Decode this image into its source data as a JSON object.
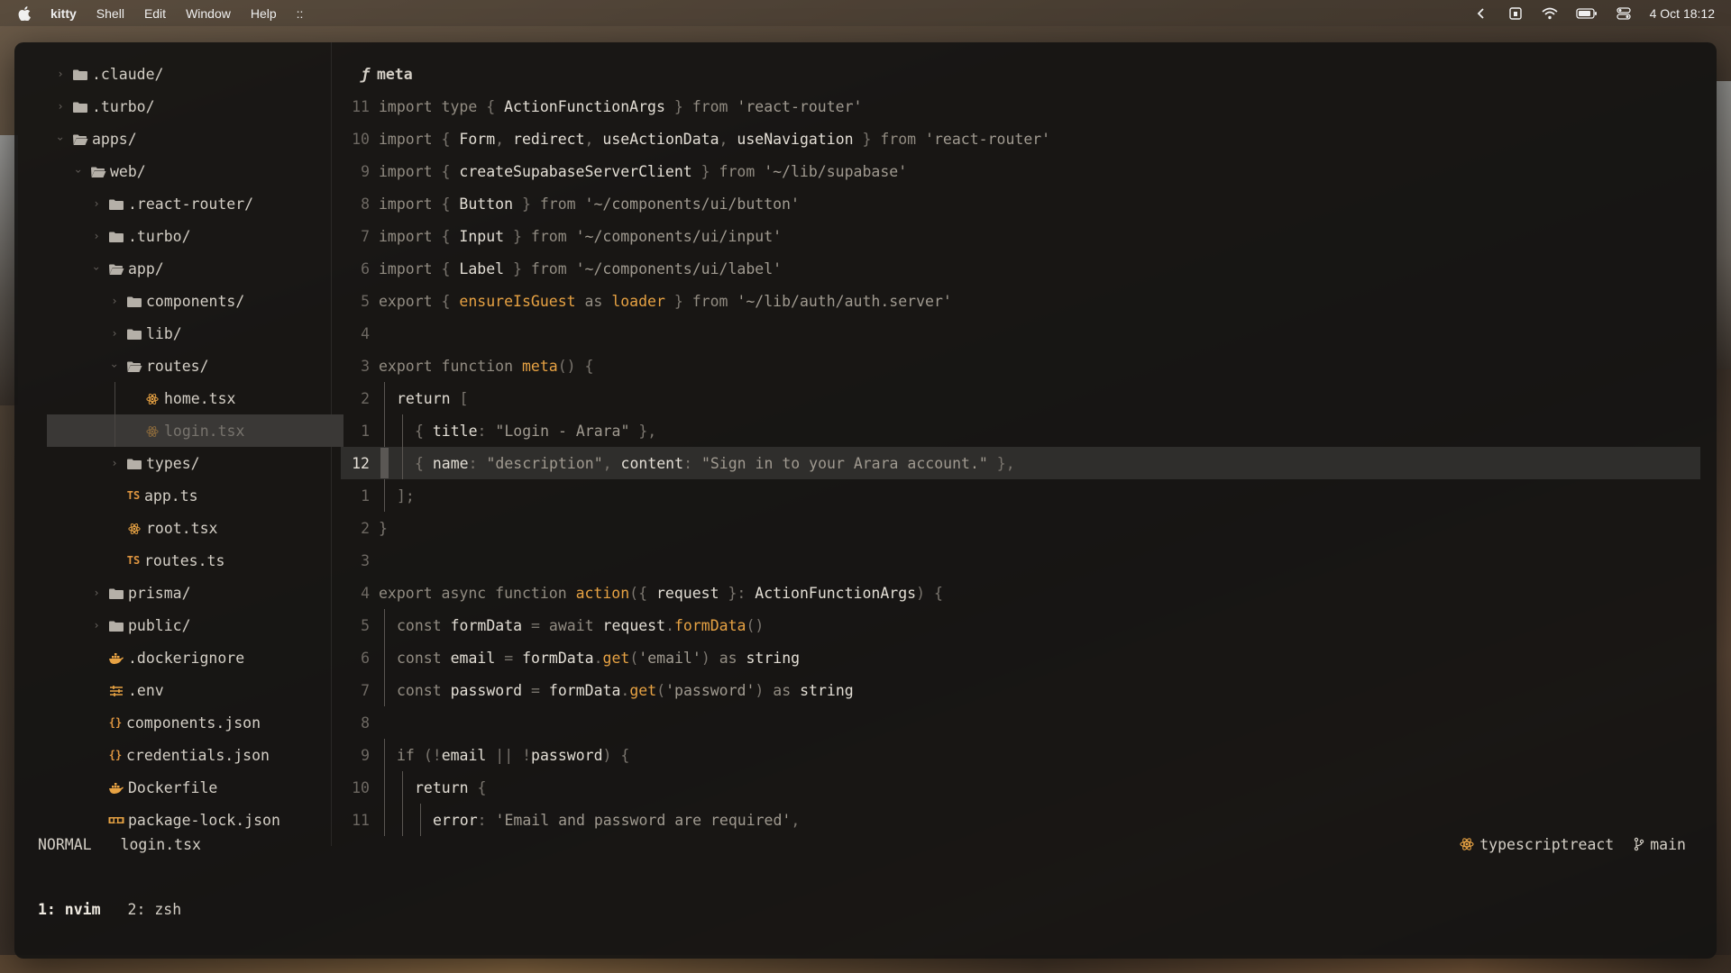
{
  "menubar": {
    "app_name": "kitty",
    "items": [
      "Shell",
      "Edit",
      "Window",
      "Help",
      "::"
    ],
    "clock": "4 Oct 18:12"
  },
  "tree": [
    {
      "indent": 0,
      "chevron": ">",
      "icon": "folder-icon",
      "name": ".claude/"
    },
    {
      "indent": 0,
      "chevron": ">",
      "icon": "folder-icon",
      "name": ".turbo/"
    },
    {
      "indent": 0,
      "chevron": "v",
      "icon": "folder-open-icon",
      "name": "apps/"
    },
    {
      "indent": 1,
      "chevron": "v",
      "icon": "folder-open-icon",
      "name": "web/"
    },
    {
      "indent": 2,
      "chevron": ">",
      "icon": "folder-icon",
      "name": ".react-router/"
    },
    {
      "indent": 2,
      "chevron": ">",
      "icon": "folder-icon",
      "name": ".turbo/"
    },
    {
      "indent": 2,
      "chevron": "v",
      "icon": "folder-open-icon",
      "name": "app/"
    },
    {
      "indent": 3,
      "chevron": ">",
      "icon": "folder-icon",
      "name": "components/"
    },
    {
      "indent": 3,
      "chevron": ">",
      "icon": "folder-icon",
      "name": "lib/"
    },
    {
      "indent": 3,
      "chevron": "v",
      "icon": "folder-open-icon",
      "name": "routes/"
    },
    {
      "indent": 4,
      "chevron": "",
      "icon": "react-icon",
      "name": "home.tsx"
    },
    {
      "indent": 4,
      "chevron": "",
      "icon": "react-icon",
      "name": "login.tsx",
      "selected": true
    },
    {
      "indent": 3,
      "chevron": ">",
      "icon": "folder-icon",
      "name": "types/"
    },
    {
      "indent": 3,
      "chevron": "",
      "icon": "ts-icon",
      "name": "app.ts"
    },
    {
      "indent": 3,
      "chevron": "",
      "icon": "react-icon",
      "name": "root.tsx"
    },
    {
      "indent": 3,
      "chevron": "",
      "icon": "ts-icon",
      "name": "routes.ts"
    },
    {
      "indent": 2,
      "chevron": ">",
      "icon": "folder-icon",
      "name": "prisma/"
    },
    {
      "indent": 2,
      "chevron": ">",
      "icon": "folder-icon",
      "name": "public/"
    },
    {
      "indent": 2,
      "chevron": "",
      "icon": "docker-icon",
      "name": ".dockerignore"
    },
    {
      "indent": 2,
      "chevron": "",
      "icon": "env-icon",
      "name": ".env"
    },
    {
      "indent": 2,
      "chevron": "",
      "icon": "json-icon",
      "name": "components.json"
    },
    {
      "indent": 2,
      "chevron": "",
      "icon": "json-icon",
      "name": "credentials.json"
    },
    {
      "indent": 2,
      "chevron": "",
      "icon": "docker-icon",
      "name": "Dockerfile"
    },
    {
      "indent": 2,
      "chevron": "",
      "icon": "npm-icon",
      "name": "package-lock.json"
    }
  ],
  "icon_glyphs": {
    "ts-icon": "TS",
    "json-icon": "{}"
  },
  "editor": {
    "winbar_symbol": "ƒ",
    "winbar": "meta",
    "lines": [
      {
        "n": "11",
        "ind": 0,
        "t": [
          [
            "k",
            "import "
          ],
          [
            "k",
            "type "
          ],
          [
            "p",
            "{ "
          ],
          [
            "i",
            "ActionFunctionArgs"
          ],
          [
            "p",
            " } "
          ],
          [
            "k",
            "from "
          ],
          [
            "s",
            "'react-router'"
          ]
        ]
      },
      {
        "n": "10",
        "ind": 0,
        "t": [
          [
            "k",
            "import "
          ],
          [
            "p",
            "{ "
          ],
          [
            "i",
            "Form"
          ],
          [
            "p",
            ", "
          ],
          [
            "i",
            "redirect"
          ],
          [
            "p",
            ", "
          ],
          [
            "i",
            "useActionData"
          ],
          [
            "p",
            ", "
          ],
          [
            "i",
            "useNavigation"
          ],
          [
            "p",
            " } "
          ],
          [
            "k",
            "from "
          ],
          [
            "s",
            "'react-router'"
          ]
        ]
      },
      {
        "n": "9",
        "ind": 0,
        "t": [
          [
            "k",
            "import "
          ],
          [
            "p",
            "{ "
          ],
          [
            "i",
            "createSupabaseServerClient"
          ],
          [
            "p",
            " } "
          ],
          [
            "k",
            "from "
          ],
          [
            "s",
            "'~/lib/supabase'"
          ]
        ]
      },
      {
        "n": "8",
        "ind": 0,
        "t": [
          [
            "k",
            "import "
          ],
          [
            "p",
            "{ "
          ],
          [
            "i",
            "Button"
          ],
          [
            "p",
            " } "
          ],
          [
            "k",
            "from "
          ],
          [
            "s",
            "'~/components/ui/button'"
          ]
        ]
      },
      {
        "n": "7",
        "ind": 0,
        "t": [
          [
            "k",
            "import "
          ],
          [
            "p",
            "{ "
          ],
          [
            "i",
            "Input"
          ],
          [
            "p",
            " } "
          ],
          [
            "k",
            "from "
          ],
          [
            "s",
            "'~/components/ui/input'"
          ]
        ]
      },
      {
        "n": "6",
        "ind": 0,
        "t": [
          [
            "k",
            "import "
          ],
          [
            "p",
            "{ "
          ],
          [
            "i",
            "Label"
          ],
          [
            "p",
            " } "
          ],
          [
            "k",
            "from "
          ],
          [
            "s",
            "'~/components/ui/label'"
          ]
        ]
      },
      {
        "n": "5",
        "ind": 0,
        "t": [
          [
            "k",
            "export "
          ],
          [
            "p",
            "{ "
          ],
          [
            "fn",
            "ensureIsGuest"
          ],
          [
            "k",
            " as "
          ],
          [
            "fn",
            "loader"
          ],
          [
            "p",
            " } "
          ],
          [
            "k",
            "from "
          ],
          [
            "s",
            "'~/lib/auth/auth.server'"
          ]
        ]
      },
      {
        "n": "4",
        "ind": 0,
        "t": []
      },
      {
        "n": "3",
        "ind": 0,
        "t": [
          [
            "k",
            "export "
          ],
          [
            "k",
            "function "
          ],
          [
            "fn",
            "meta"
          ],
          [
            "p",
            "() {"
          ]
        ]
      },
      {
        "n": "2",
        "ind": 1,
        "t": [
          [
            "i",
            "return "
          ],
          [
            "p",
            "["
          ]
        ]
      },
      {
        "n": "1",
        "ind": 2,
        "t": [
          [
            "p",
            "{ "
          ],
          [
            "i",
            "title"
          ],
          [
            "p",
            ": "
          ],
          [
            "s",
            "\"Login - Arara\""
          ],
          [
            "p",
            " },"
          ]
        ]
      },
      {
        "n": "12",
        "ind": 2,
        "cur": true,
        "t": [
          [
            "p",
            "{ "
          ],
          [
            "i",
            "name"
          ],
          [
            "p",
            ": "
          ],
          [
            "s",
            "\"description\""
          ],
          [
            "p",
            ", "
          ],
          [
            "i",
            "content"
          ],
          [
            "p",
            ": "
          ],
          [
            "s",
            "\"Sign in to your Arara account.\""
          ],
          [
            "p",
            " },"
          ]
        ]
      },
      {
        "n": "1",
        "ind": 1,
        "t": [
          [
            "p",
            "];"
          ]
        ]
      },
      {
        "n": "2",
        "ind": 0,
        "t": [
          [
            "p",
            "}"
          ]
        ]
      },
      {
        "n": "3",
        "ind": 0,
        "t": []
      },
      {
        "n": "4",
        "ind": 0,
        "t": [
          [
            "k",
            "export "
          ],
          [
            "k",
            "async "
          ],
          [
            "k",
            "function "
          ],
          [
            "fn",
            "action"
          ],
          [
            "p",
            "({ "
          ],
          [
            "i",
            "request"
          ],
          [
            "p",
            " }: "
          ],
          [
            "i",
            "ActionFunctionArgs"
          ],
          [
            "p",
            ") {"
          ]
        ]
      },
      {
        "n": "5",
        "ind": 1,
        "t": [
          [
            "k",
            "const "
          ],
          [
            "i",
            "formData"
          ],
          [
            "p",
            " = "
          ],
          [
            "k",
            "await "
          ],
          [
            "i",
            "request"
          ],
          [
            "p",
            "."
          ],
          [
            "fn",
            "formData"
          ],
          [
            "p",
            "()"
          ]
        ]
      },
      {
        "n": "6",
        "ind": 1,
        "t": [
          [
            "k",
            "const "
          ],
          [
            "i",
            "email"
          ],
          [
            "p",
            " = "
          ],
          [
            "i",
            "formData"
          ],
          [
            "p",
            "."
          ],
          [
            "fn",
            "get"
          ],
          [
            "p",
            "("
          ],
          [
            "s",
            "'email'"
          ],
          [
            "p",
            ") "
          ],
          [
            "k",
            "as "
          ],
          [
            "i",
            "string"
          ]
        ]
      },
      {
        "n": "7",
        "ind": 1,
        "t": [
          [
            "k",
            "const "
          ],
          [
            "i",
            "password"
          ],
          [
            "p",
            " = "
          ],
          [
            "i",
            "formData"
          ],
          [
            "p",
            "."
          ],
          [
            "fn",
            "get"
          ],
          [
            "p",
            "("
          ],
          [
            "s",
            "'password'"
          ],
          [
            "p",
            ") "
          ],
          [
            "k",
            "as "
          ],
          [
            "i",
            "string"
          ]
        ]
      },
      {
        "n": "8",
        "ind": 0,
        "t": []
      },
      {
        "n": "9",
        "ind": 1,
        "t": [
          [
            "k",
            "if "
          ],
          [
            "p",
            "(!"
          ],
          [
            "i",
            "email"
          ],
          [
            "p",
            " || !"
          ],
          [
            "i",
            "password"
          ],
          [
            "p",
            ") {"
          ]
        ]
      },
      {
        "n": "10",
        "ind": 2,
        "t": [
          [
            "i",
            "return "
          ],
          [
            "p",
            "{"
          ]
        ]
      },
      {
        "n": "11",
        "ind": 3,
        "t": [
          [
            "i",
            "error"
          ],
          [
            "p",
            ": "
          ],
          [
            "s",
            "'Email and password are required'"
          ],
          [
            "p",
            ","
          ]
        ]
      }
    ]
  },
  "status": {
    "mode": "NORMAL",
    "file": "login.tsx",
    "filetype": "typescriptreact",
    "branch": "main"
  },
  "tabs": [
    {
      "label": "1: nvim",
      "active": true
    },
    {
      "label": "2: zsh",
      "active": false
    }
  ],
  "colors": {
    "accent": "#e7a243",
    "background": "#141312"
  }
}
